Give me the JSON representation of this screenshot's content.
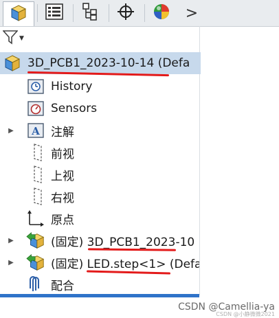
{
  "tabs": [
    {
      "name": "feature-manager",
      "icon": "feature-manager-icon",
      "active": true
    },
    {
      "name": "property-manager",
      "icon": "property-list-icon"
    },
    {
      "name": "configuration-manager",
      "icon": "configuration-tree-icon"
    },
    {
      "name": "dimxpert-manager",
      "icon": "crosshair-icon"
    },
    {
      "name": "display-manager",
      "icon": "display-sphere-icon"
    }
  ],
  "tab_overflow": ">",
  "filter": {
    "icon": "filter-funnel-icon"
  },
  "tree": {
    "root": {
      "label": "3D_PCB1_2023-10-14  (Defa",
      "icon": "assembly-icon"
    },
    "items": [
      {
        "label": "History",
        "icon": "history-icon",
        "expandable": false
      },
      {
        "label": "Sensors",
        "icon": "sensors-icon",
        "expandable": false
      },
      {
        "label": "注解",
        "icon": "annotations-icon",
        "expandable": true
      },
      {
        "label": "前视",
        "icon": "plane-icon",
        "expandable": false
      },
      {
        "label": "上视",
        "icon": "plane-icon",
        "expandable": false
      },
      {
        "label": "右视",
        "icon": "plane-icon",
        "expandable": false
      },
      {
        "label": "原点",
        "icon": "origin-icon",
        "expandable": false
      },
      {
        "label": "(固定) 3D_PCB1_2023-10",
        "icon": "part-component-icon",
        "expandable": true
      },
      {
        "label": "(固定) LED.step<1> (Defa",
        "icon": "part-component-icon",
        "expandable": true
      },
      {
        "label": "配合",
        "icon": "mates-icon",
        "expandable": false
      }
    ]
  },
  "colors": {
    "selected_row": "#c7d9ec",
    "annotation_red": "#e31a1a",
    "accent_blue": "#2f73c9"
  },
  "watermark": "CSDN @Camellia-ya",
  "watermark_small": "CSDN @小静微微2021"
}
